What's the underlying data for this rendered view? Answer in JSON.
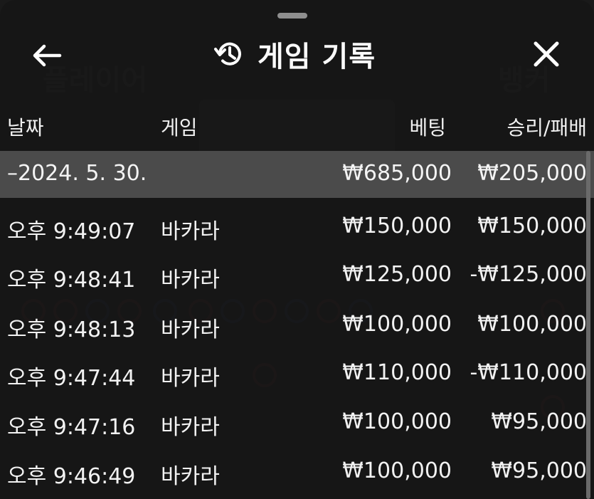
{
  "header": {
    "title": "게임 기록",
    "back_icon": "arrow-left-icon",
    "history_icon": "history-icon",
    "close_icon": "close-icon"
  },
  "columns": {
    "date": "날짜",
    "game": "게임",
    "bet": "베팅",
    "result": "승리/패배"
  },
  "date_group": {
    "label": "–2024. 5. 30.",
    "bet_total": "₩685,000",
    "result_total": "₩205,000"
  },
  "rows": [
    {
      "time": "오후 9:49:07",
      "game": "바카라",
      "bet": "₩150,000",
      "result": "₩150,000"
    },
    {
      "time": "오후 9:48:41",
      "game": "바카라",
      "bet": "₩125,000",
      "result": "-₩125,000"
    },
    {
      "time": "오후 9:48:13",
      "game": "바카라",
      "bet": "₩100,000",
      "result": "₩100,000"
    },
    {
      "time": "오후 9:47:44",
      "game": "바카라",
      "bet": "₩110,000",
      "result": "-₩110,000"
    },
    {
      "time": "오후 9:47:16",
      "game": "바카라",
      "bet": "₩100,000",
      "result": "₩95,000"
    },
    {
      "time": "오후 9:46:49",
      "game": "바카라",
      "bet": "₩100,000",
      "result": "₩95,000"
    }
  ],
  "colors": {
    "sheet_bg": "#161616",
    "date_row_bg": "#5f5f5f",
    "text": "#f2f2f2"
  }
}
